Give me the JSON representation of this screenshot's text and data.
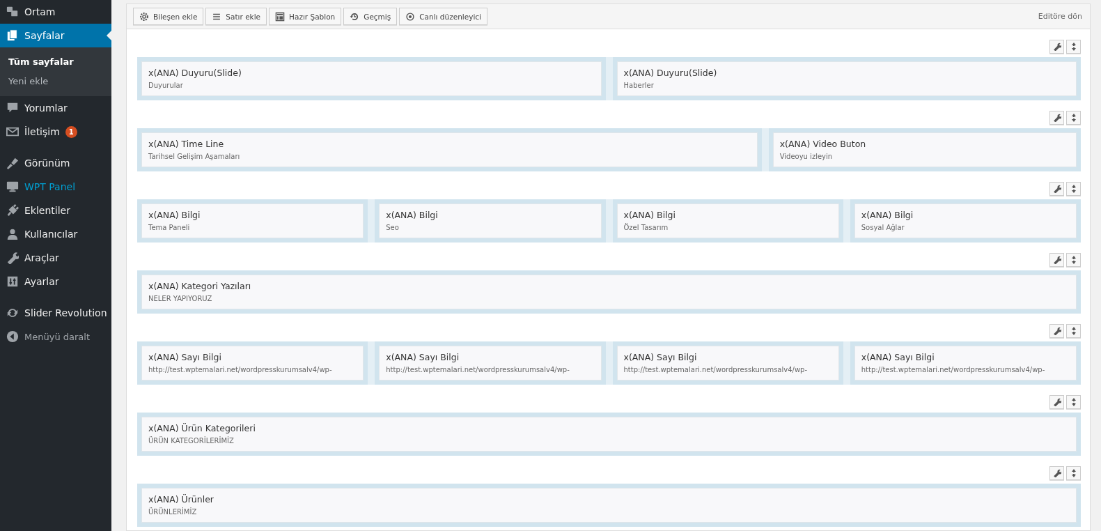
{
  "sidebar": {
    "items": [
      {
        "kind": "item",
        "label": "Ortam",
        "selected": false,
        "highlighted": false
      },
      {
        "kind": "item",
        "label": "Sayfalar",
        "selected": true,
        "highlighted": false,
        "children": [
          {
            "label": "Tüm sayfalar",
            "selected": true
          },
          {
            "label": "Yeni ekle",
            "selected": false
          }
        ]
      },
      {
        "kind": "item",
        "label": "Yorumlar",
        "selected": false,
        "highlighted": false
      },
      {
        "kind": "item",
        "label": "İletişim",
        "selected": false,
        "highlighted": false,
        "badge": "1"
      },
      {
        "kind": "separator"
      },
      {
        "kind": "item",
        "label": "Görünüm",
        "selected": false,
        "highlighted": false
      },
      {
        "kind": "item",
        "label": "WPT Panel",
        "selected": false,
        "highlighted": true
      },
      {
        "kind": "item",
        "label": "Eklentiler",
        "selected": false,
        "highlighted": false
      },
      {
        "kind": "item",
        "label": "Kullanıcılar",
        "selected": false,
        "highlighted": false
      },
      {
        "kind": "item",
        "label": "Araçlar",
        "selected": false,
        "highlighted": false
      },
      {
        "kind": "item",
        "label": "Ayarlar",
        "selected": false,
        "highlighted": false
      },
      {
        "kind": "separator"
      },
      {
        "kind": "item",
        "label": "Slider Revolution",
        "selected": false,
        "highlighted": false
      },
      {
        "kind": "collapse",
        "label": "Menüyü daralt"
      }
    ]
  },
  "toolbar": {
    "buttons": [
      {
        "label": "Bileşen ekle"
      },
      {
        "label": "Satır ekle"
      },
      {
        "label": "Hazır Şablon"
      },
      {
        "label": "Geçmiş"
      },
      {
        "label": "Canlı düzenleyici"
      }
    ],
    "link": "Editöre dön"
  },
  "rows": [
    {
      "columns": [
        {
          "title": "x(ANA) Duyuru(Slide)",
          "subtitle": "Duyurular"
        },
        {
          "title": "x(ANA) Duyuru(Slide)",
          "subtitle": "Haberler"
        }
      ]
    },
    {
      "columns": [
        {
          "title": "x(ANA) Time Line",
          "subtitle": "Tarihsel Gelişim Aşamaları"
        },
        {
          "title": "x(ANA) Video Buton",
          "subtitle": "Videoyu izleyin"
        }
      ]
    },
    {
      "columns": [
        {
          "title": "x(ANA) Bilgi",
          "subtitle": "Tema Paneli"
        },
        {
          "title": "x(ANA) Bilgi",
          "subtitle": "Seo"
        },
        {
          "title": "x(ANA) Bilgi",
          "subtitle": "Özel Tasarım"
        },
        {
          "title": "x(ANA) Bilgi",
          "subtitle": "Sosyal Ağlar"
        }
      ]
    },
    {
      "columns": [
        {
          "title": "x(ANA) Kategori Yazıları",
          "subtitle": "NELER YAPIYORUZ"
        }
      ]
    },
    {
      "columns": [
        {
          "title": "x(ANA) Sayı Bilgi",
          "subtitle": "http://test.wptemalari.net/wordpresskurumsalv4/wp-"
        },
        {
          "title": "x(ANA) Sayı Bilgi",
          "subtitle": "http://test.wptemalari.net/wordpresskurumsalv4/wp-"
        },
        {
          "title": "x(ANA) Sayı Bilgi",
          "subtitle": "http://test.wptemalari.net/wordpresskurumsalv4/wp-"
        },
        {
          "title": "x(ANA) Sayı Bilgi",
          "subtitle": "http://test.wptemalari.net/wordpresskurumsalv4/wp-"
        }
      ]
    },
    {
      "columns": [
        {
          "title": "x(ANA) Ürün Kategorileri",
          "subtitle": "ÜRÜN KATEGORİLERİMİZ"
        }
      ]
    },
    {
      "columns": [
        {
          "title": "x(ANA) Ürünler",
          "subtitle": "ÜRÜNLERİMİZ"
        }
      ]
    }
  ]
}
